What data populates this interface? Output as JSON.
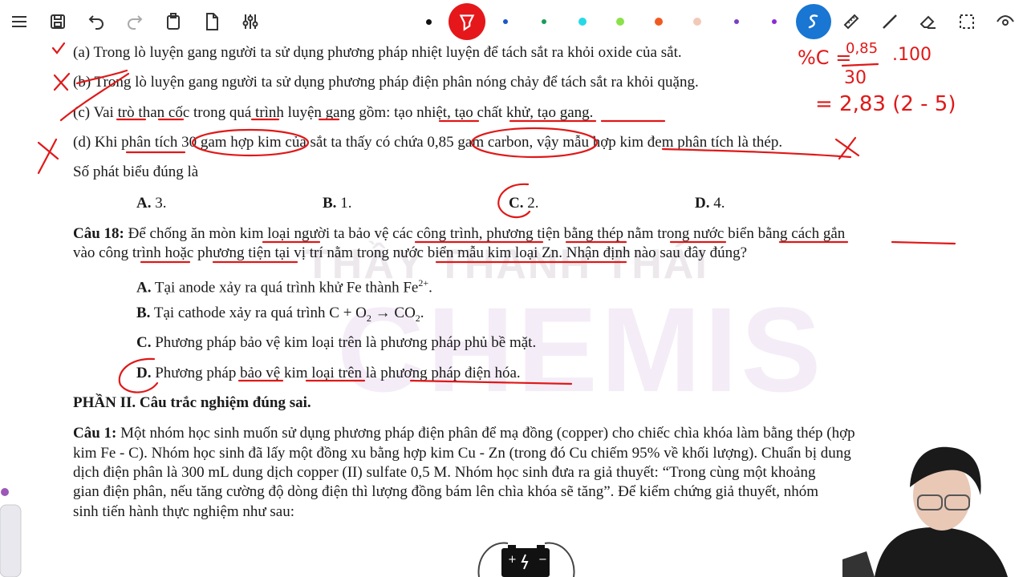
{
  "toolbar": {
    "left_icons": [
      "menu-icon",
      "save-icon",
      "undo-icon",
      "redo-icon",
      "clipboard-icon",
      "page-icon",
      "sliders-icon"
    ],
    "pen_colors": [
      "#111111",
      "#1a57c8",
      "#1a9c5a",
      "#27d9e6",
      "#8be14a",
      "#f05a22",
      "#f2c9b8",
      "#7a3fc2",
      "#8b2bd6"
    ],
    "right_icons": [
      "highlighter-icon",
      "ruler-icon",
      "line-icon",
      "eraser-icon",
      "selection-icon",
      "eye-icon"
    ]
  },
  "doc": {
    "q17a": "(a) Trong lò luyện gang người ta sử dụng phương pháp nhiệt luyện để tách sắt ra khỏi oxide của sắt.",
    "q17b": "(b) Trong lò luyện gang người ta sử dụng phương pháp điện phân nóng chảy để tách sắt ra khỏi quặng.",
    "q17c": "(c) Vai trò than cốc trong quá trình luyện gang gồm: tạo nhiệt, tạo chất khử, tạo gang.",
    "q17d": "(d) Khi phân tích 30 gam hợp kim của sắt ta thấy có chứa 0,85 gam carbon, vậy mẫu hợp kim đem phân tích là thép.",
    "q17_prompt": "Số phát biểu đúng là",
    "q17_opts": [
      {
        "key": "A.",
        "val": "3."
      },
      {
        "key": "B.",
        "val": "1."
      },
      {
        "key": "C.",
        "val": "2."
      },
      {
        "key": "D.",
        "val": "4."
      }
    ],
    "q18_label": "Câu 18:",
    "q18_line1": "Để chống ăn mòn kim loại người ta bảo vệ các công trình, phương tiện bằng thép nằm trong nước biển bằng cách gắn",
    "q18_line2": "vào công trình hoặc phương tiện tại vị trí nằm trong nước biển mẫu kim loại Zn. Nhận định nào sau đây đúng?",
    "q18_A_key": "A.",
    "q18_A": "Tại anode xảy ra quá trình khử Fe thành Fe",
    "q18_A_sup": "2+",
    "q18_A_end": ".",
    "q18_B_key": "B.",
    "q18_B_pre": "Tại cathode xảy ra quá trình C + O",
    "q18_B_sub1": "2",
    "q18_B_mid": " → CO",
    "q18_B_sub2": "2",
    "q18_B_end": ".",
    "q18_C_key": "C.",
    "q18_C": "Phương pháp bảo vệ kim loại trên là phương pháp phủ bề mặt.",
    "q18_D_key": "D.",
    "q18_D": "Phương pháp bảo vệ kim loại trên là phương pháp điện hóa.",
    "part2": "PHẦN II. Câu trắc nghiệm đúng sai.",
    "q1_label": "Câu 1:",
    "q1_line1": "Một nhóm học sinh muốn sử dụng phương pháp điện phân để mạ đồng (copper) cho chiếc chìa khóa làm bằng thép (hợp",
    "q1_line2": "kim Fe - C). Nhóm học sinh đã lấy một đồng xu bằng hợp kim Cu - Zn (trong đó Cu chiếm 95% về khối lượng). Chuẩn bị dung",
    "q1_line3": "dịch điện phân là 300 mL dung dịch copper (II) sulfate 0,5 M. Nhóm học sinh đưa ra giả thuyết: “Trong cùng một khoảng",
    "q1_line4": "gian điện phân, nếu tăng cường độ dòng điện thì lượng đồng bám lên chìa khóa sẽ tăng”. Để kiểm chứng giả thuyết, nhóm",
    "q1_line5": "sinh tiến hành thực nghiệm như sau:"
  },
  "watermark": {
    "line1": "THẦY THANH THÁI",
    "line2": "CHEMIS"
  },
  "ink": {
    "calc1": "%C =",
    "calc_num": "0,85",
    "calc_den": "30",
    "calc_mult": ".100",
    "calc2": "= 2,83 (2 - 5)"
  },
  "accent_red": "#e01818",
  "accent_blue": "#1976d2"
}
